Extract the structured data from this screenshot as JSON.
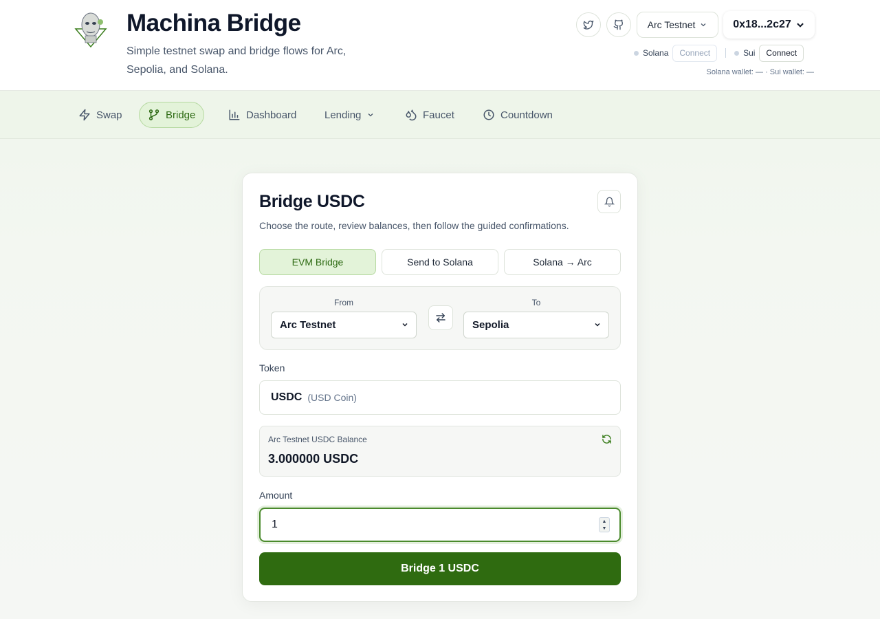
{
  "header": {
    "title": "Machina Bridge",
    "subtitle": "Simple testnet swap and bridge flows for Arc, Sepolia, and Solana.",
    "twitter_icon": "twitter-icon",
    "github_icon": "github-icon",
    "network_select": "Arc Testnet",
    "wallet_address": "0x18...2c27",
    "solana": {
      "label": "Solana",
      "connect": "Connect"
    },
    "sui": {
      "label": "Sui",
      "connect": "Connect"
    },
    "wallet_status": "Solana wallet: — · Sui wallet: —"
  },
  "nav": {
    "items": [
      {
        "label": "Swap",
        "icon": "lightning-icon"
      },
      {
        "label": "Bridge",
        "icon": "git-branch-icon",
        "active": true
      },
      {
        "label": "Dashboard",
        "icon": "bar-chart-icon"
      },
      {
        "label": "Lending",
        "icon": "chevron-down-icon"
      },
      {
        "label": "Faucet",
        "icon": "droplets-icon"
      },
      {
        "label": "Countdown",
        "icon": "clock-icon"
      }
    ]
  },
  "card": {
    "title": "Bridge USDC",
    "subtitle": "Choose the route, review balances, then follow the guided confirmations.",
    "tabs": [
      "EVM Bridge",
      "Send to Solana",
      "Solana → Arc"
    ],
    "active_tab": 0,
    "route": {
      "from_label": "From",
      "from_value": "Arc Testnet",
      "to_label": "To",
      "to_value": "Sepolia"
    },
    "token_label": "Token",
    "token_symbol": "USDC",
    "token_name": "(USD Coin)",
    "balance_label": "Arc Testnet USDC Balance",
    "balance_value": "3.000000 USDC",
    "amount_label": "Amount",
    "amount_value": "1",
    "submit_label": "Bridge 1 USDC"
  },
  "colors": {
    "accent": "#2f6b10",
    "accent_light": "#e3f3d9",
    "accent_border": "#b5d9a0"
  }
}
